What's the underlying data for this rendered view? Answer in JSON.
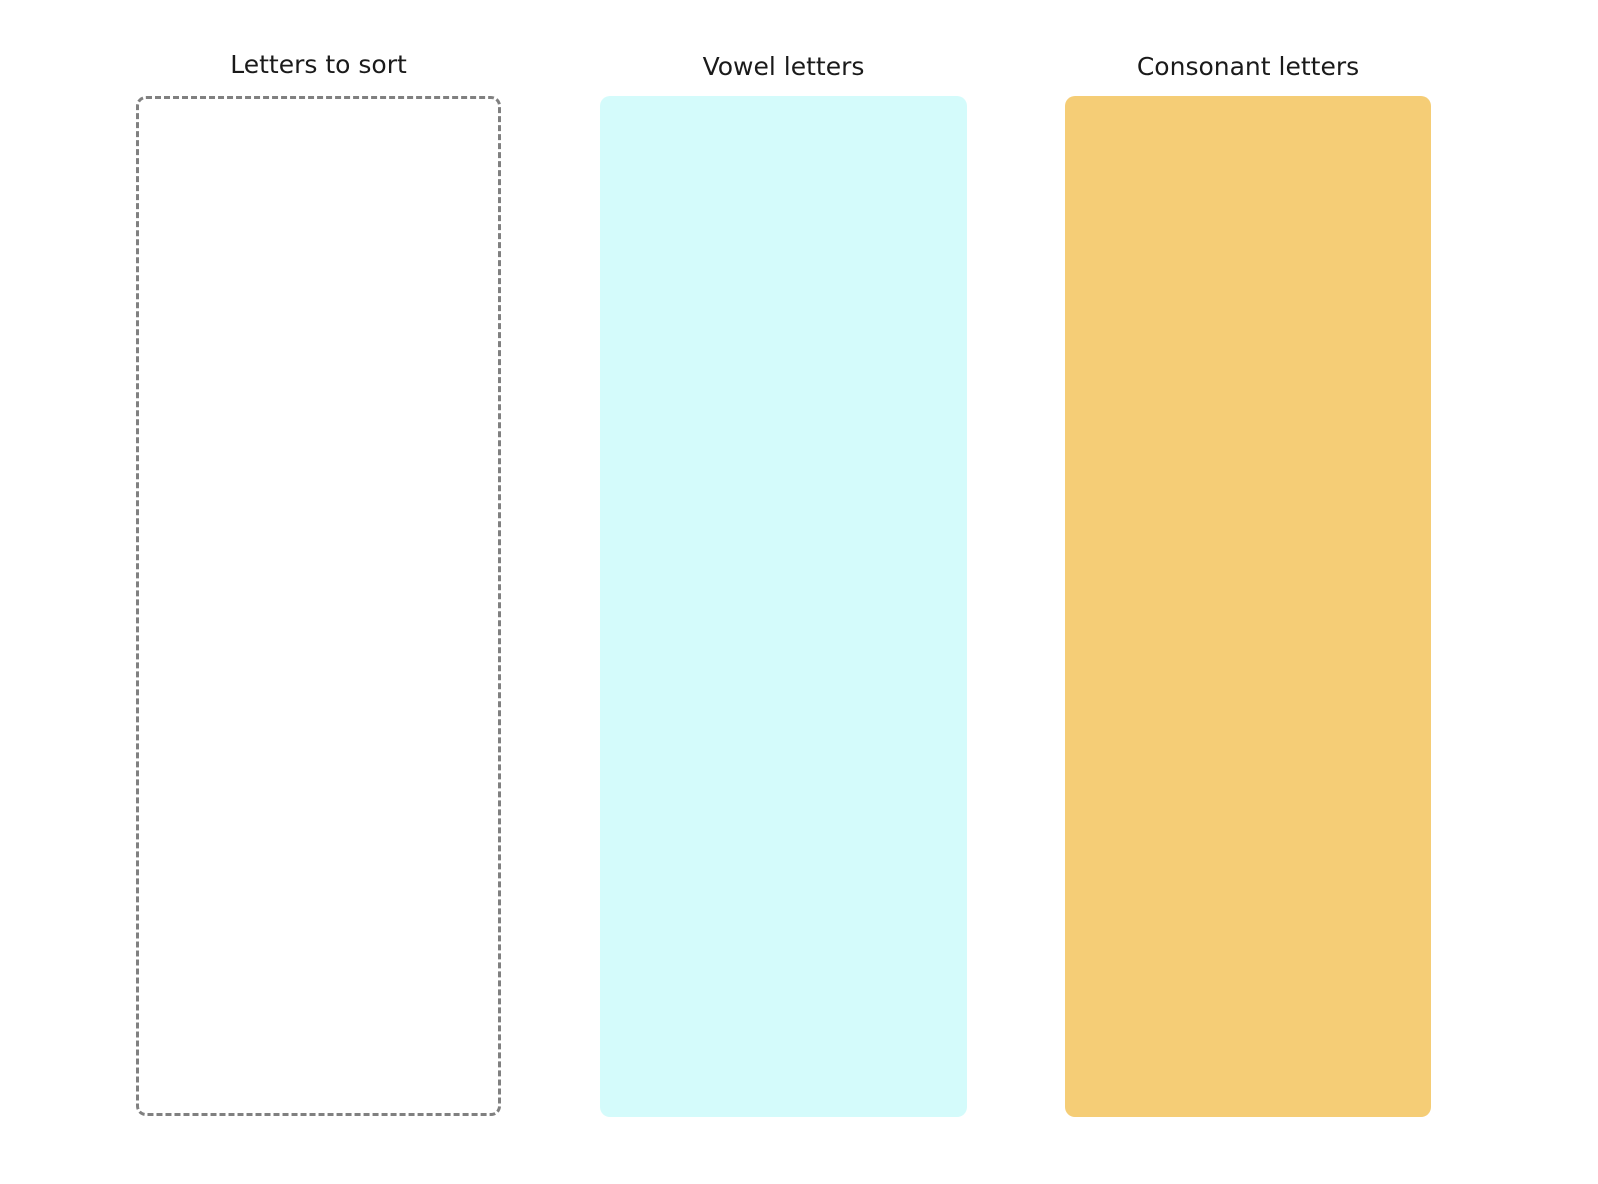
{
  "columns": {
    "source": {
      "title": "Letters to sort",
      "style": "dashed-border",
      "border_color": "#808080",
      "fill_color": "#ffffff",
      "items": []
    },
    "vowels": {
      "title": "Vowel letters",
      "fill_color": "#d4fbfb",
      "items": []
    },
    "consonants": {
      "title": "Consonant letters",
      "fill_color": "#f5cd76",
      "items": []
    }
  }
}
